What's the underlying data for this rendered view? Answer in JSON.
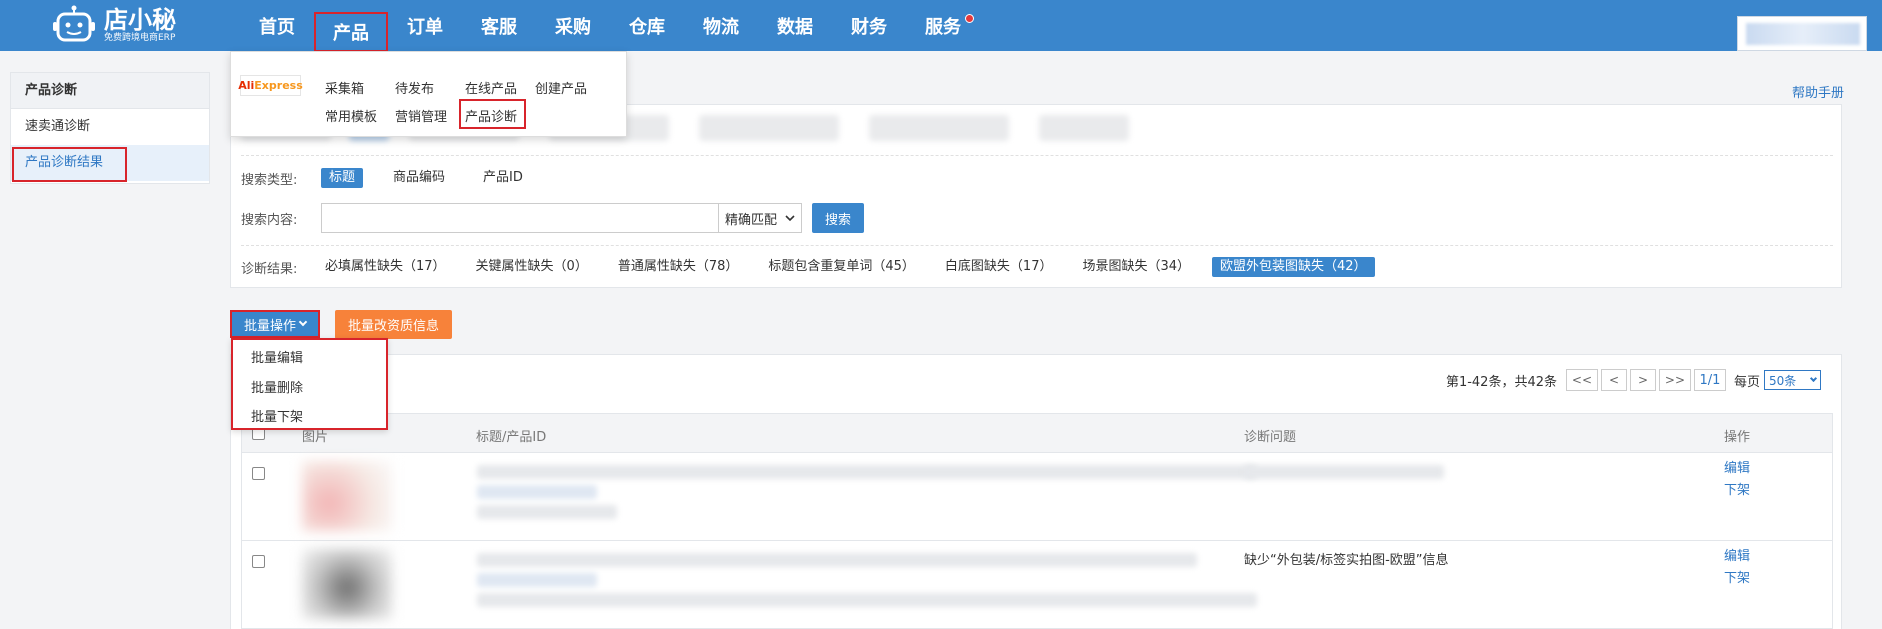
{
  "brand": {
    "title": "店小秘",
    "subtitle": "免费跨境电商ERP"
  },
  "nav": [
    {
      "label": "首页"
    },
    {
      "label": "产品"
    },
    {
      "label": "订单"
    },
    {
      "label": "客服"
    },
    {
      "label": "采购"
    },
    {
      "label": "仓库"
    },
    {
      "label": "物流"
    },
    {
      "label": "数据"
    },
    {
      "label": "财务"
    },
    {
      "label": "服务"
    }
  ],
  "product_menu": {
    "platform_logo_a": "Ali",
    "platform_logo_b": "Express",
    "row1": [
      "采集箱",
      "待发布",
      "在线产品",
      "创建产品"
    ],
    "row2": [
      "常用模板",
      "营销管理",
      "产品诊断"
    ]
  },
  "sidebar": {
    "header": "产品诊断",
    "items": [
      {
        "label": "速卖通诊断"
      },
      {
        "label": "产品诊断结果"
      }
    ]
  },
  "help_link": "帮助手册",
  "filters": {
    "search_type_label": "搜索类型:",
    "search_types": [
      "标题",
      "商品编码",
      "产品ID"
    ],
    "search_content_label": "搜索内容:",
    "match_mode": "精确匹配",
    "search_button": "搜索",
    "result_label": "诊断结果:",
    "results": [
      "必填属性缺失（17）",
      "关键属性缺失（0）",
      "普通属性缺失（78）",
      "标题包含重复单词（45）",
      "白底图缺失（17）",
      "场景图缺失（34）",
      "欧盟外包装图缺失（42）"
    ]
  },
  "batch": {
    "batch_ops": "批量操作",
    "batch_info": "批量改资质信息",
    "menu": [
      "批量编辑",
      "批量删除",
      "批量下架"
    ]
  },
  "pager": {
    "summary": "第1-42条，共42条",
    "first": "<<",
    "prev": "<",
    "next": ">",
    "last": ">>",
    "page": "1/1",
    "per_page_label": "每页",
    "per_page": "50条"
  },
  "table": {
    "headers": {
      "image": "图片",
      "title": "标题/产品ID",
      "issue": "诊断问题",
      "ops": "操作"
    },
    "rows": [
      {
        "issue": "",
        "edit": "编辑",
        "delist": "下架"
      },
      {
        "issue": "缺少“外包装/标签实拍图-欧盟”信息",
        "edit": "编辑",
        "delist": "下架"
      }
    ]
  },
  "colors": {
    "topbar": "#3a86cc",
    "accent": "#3a86cc",
    "orange": "#f7823a",
    "highlight": "#d8242b"
  }
}
